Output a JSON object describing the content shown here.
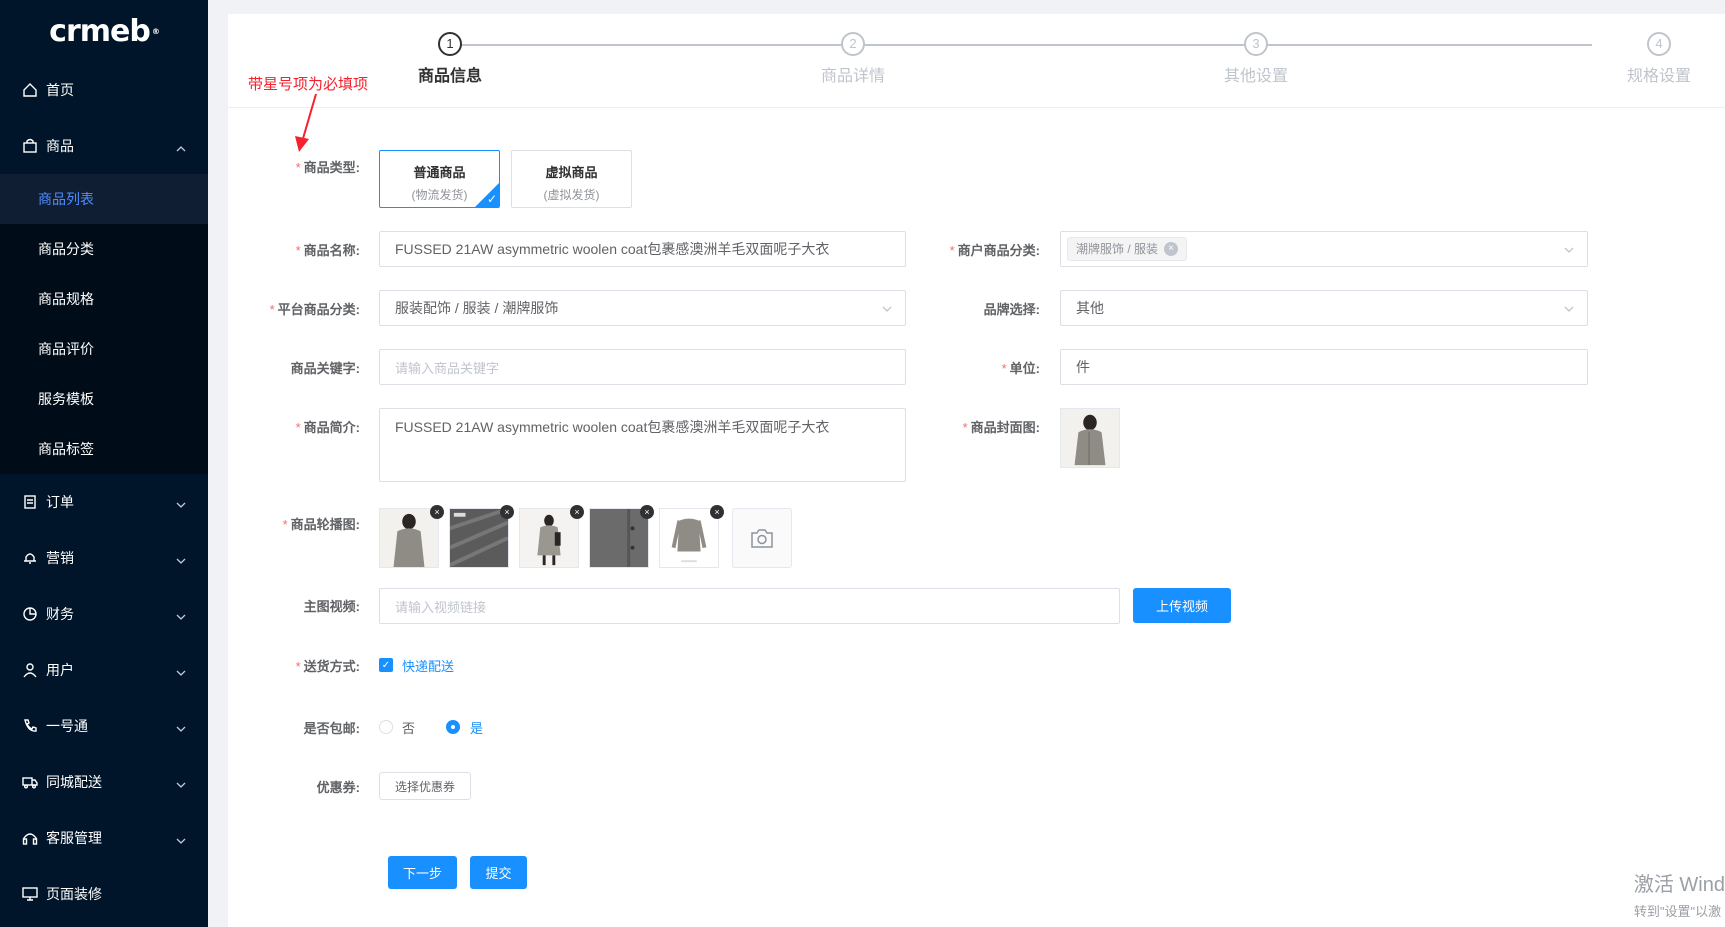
{
  "sidebar": {
    "logo": "crmeb",
    "logo_mark": "®",
    "items": [
      {
        "label": "首页",
        "icon": "home-icon"
      },
      {
        "label": "商品",
        "icon": "shopping-bag-icon"
      },
      {
        "label": "订单",
        "icon": "order-document-icon"
      },
      {
        "label": "营销",
        "icon": "bell-icon"
      },
      {
        "label": "财务",
        "icon": "pie-chart-icon"
      },
      {
        "label": "用户",
        "icon": "user-icon"
      },
      {
        "label": "一号通",
        "icon": "phone-icon"
      },
      {
        "label": "同城配送",
        "icon": "truck-icon"
      },
      {
        "label": "客服管理",
        "icon": "headset-icon"
      },
      {
        "label": "页面装修",
        "icon": "monitor-icon"
      }
    ],
    "sub_items": [
      {
        "label": "商品列表",
        "active": true
      },
      {
        "label": "商品分类"
      },
      {
        "label": "商品规格"
      },
      {
        "label": "商品评价"
      },
      {
        "label": "服务模板"
      },
      {
        "label": "商品标签"
      }
    ]
  },
  "steps": [
    {
      "num": "1",
      "title": "商品信息",
      "active": true
    },
    {
      "num": "2",
      "title": "商品详情"
    },
    {
      "num": "3",
      "title": "其他设置"
    },
    {
      "num": "4",
      "title": "规格设置"
    }
  ],
  "annotation": "带星号项为必填项",
  "form": {
    "product_type": {
      "label": "商品类型:",
      "options": [
        {
          "title": "普通商品",
          "sub": "(物流发货)",
          "selected": true
        },
        {
          "title": "虚拟商品",
          "sub": "(虚拟发货)",
          "selected": false
        }
      ]
    },
    "name": {
      "label": "商品名称:",
      "value": "FUSSED 21AW asymmetric woolen coat包裹感澳洲羊毛双面呢子大衣"
    },
    "merchant_category": {
      "label": "商户商品分类:",
      "tag": "潮牌服饰 / 服装"
    },
    "platform_category": {
      "label": "平台商品分类:",
      "value": "服装配饰 / 服装 / 潮牌服饰"
    },
    "brand": {
      "label": "品牌选择:",
      "value": "其他"
    },
    "keywords": {
      "label": "商品关键字:",
      "placeholder": "请输入商品关键字"
    },
    "unit": {
      "label": "单位:",
      "value": "件"
    },
    "intro": {
      "label": "商品简介:",
      "value": "FUSSED 21AW asymmetric woolen coat包裹感澳洲羊毛双面呢子大衣"
    },
    "cover": {
      "label": "商品封面图:"
    },
    "carousel": {
      "label": "商品轮播图:",
      "count": 5
    },
    "video": {
      "label": "主图视频:",
      "placeholder": "请输入视频链接",
      "button": "上传视频"
    },
    "delivery": {
      "label": "送货方式:",
      "option": "快递配送",
      "checked": true
    },
    "free_shipping": {
      "label": "是否包邮:",
      "options": [
        "否",
        "是"
      ],
      "selected": "是"
    },
    "coupon": {
      "label": "优惠券:",
      "button": "选择优惠券"
    }
  },
  "actions": {
    "next": "下一步",
    "submit": "提交"
  },
  "watermark": {
    "line1": "激活 Wind",
    "line2": "转到\"设置\"以激"
  },
  "colors": {
    "primary": "#1890ff",
    "sidebar_bg": "#001529",
    "required": "#f56c6c",
    "annotation": "#f5222d"
  }
}
